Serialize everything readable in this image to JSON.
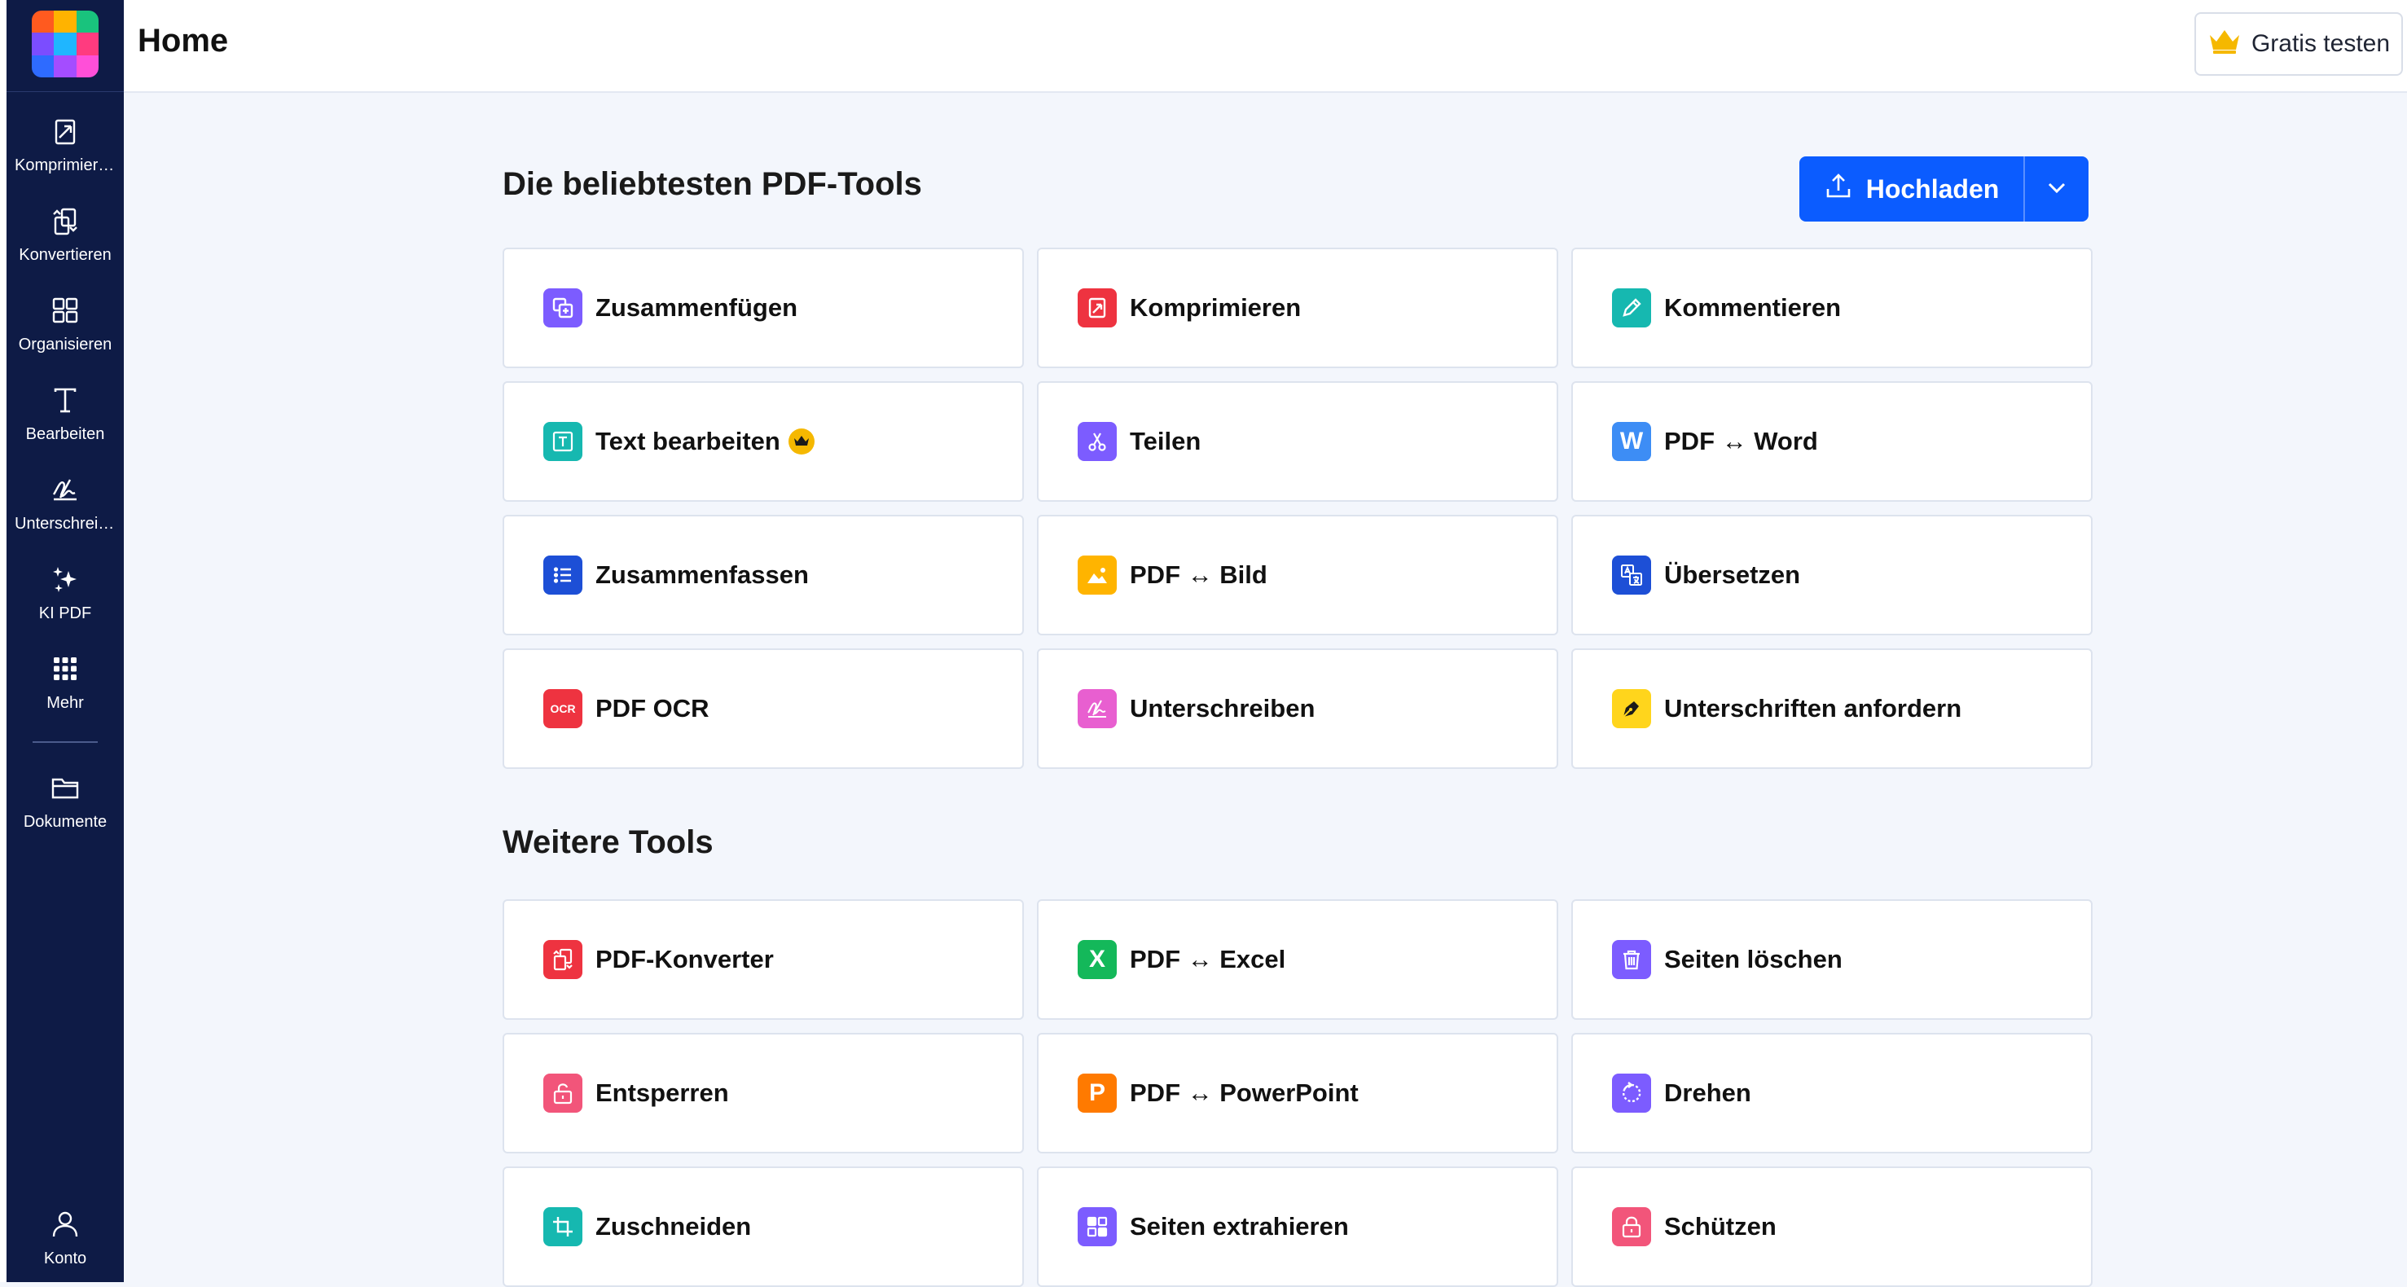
{
  "colors": {
    "sidebar_bg": "#0e1b46",
    "page_bg": "#f3f6fc",
    "primary": "#0b5cff",
    "crown": "#f5b800"
  },
  "logo_colors": [
    "#ff5a1f",
    "#ffb300",
    "#19c37d",
    "#7b4dff",
    "#1fb6ff",
    "#ff3b7f",
    "#2e6bff",
    "#a44dff",
    "#ff4fd8"
  ],
  "header": {
    "title": "Home",
    "trial_label": "Gratis testen"
  },
  "sidebar": {
    "items": [
      {
        "label": "Komprimieren",
        "icon": "compress-icon"
      },
      {
        "label": "Konvertieren",
        "icon": "convert-icon"
      },
      {
        "label": "Organisieren",
        "icon": "organize-icon"
      },
      {
        "label": "Bearbeiten",
        "icon": "edit-text-icon"
      },
      {
        "label": "Unterschreiben",
        "icon": "signature-icon"
      },
      {
        "label": "KI PDF",
        "icon": "ai-sparkle-icon"
      },
      {
        "label": "Mehr",
        "icon": "grid-dots-icon"
      },
      {
        "label": "Dokumente",
        "icon": "folder-icon"
      }
    ],
    "account_label": "Konto"
  },
  "popular": {
    "title": "Die beliebtesten PDF-Tools",
    "upload_label": "Hochladen",
    "tools": [
      {
        "name": "Zusammenfügen",
        "icon": "merge-icon",
        "color": "#7c5cff"
      },
      {
        "name": "Komprimieren",
        "icon": "compress-icon",
        "color": "#ee3340"
      },
      {
        "name": "Kommentieren",
        "icon": "pencil-icon",
        "color": "#16b8b0"
      },
      {
        "name": "Text bearbeiten",
        "icon": "text-edit-icon",
        "color": "#16b8b0",
        "premium": true
      },
      {
        "name": "Teilen",
        "icon": "scissors-icon",
        "color": "#7c5cff"
      },
      {
        "name": "PDF ↔ Word",
        "icon": "word-icon",
        "color": "#3d8df5"
      },
      {
        "name": "Zusammenfassen",
        "icon": "list-icon",
        "color": "#1d4fd6"
      },
      {
        "name": "PDF ↔ Bild",
        "icon": "image-icon",
        "color": "#ffb400"
      },
      {
        "name": "Übersetzen",
        "icon": "translate-icon",
        "color": "#1d4fd6"
      },
      {
        "name": "PDF OCR",
        "icon": "ocr-icon",
        "color": "#ee3340"
      },
      {
        "name": "Unterschreiben",
        "icon": "signature-icon",
        "color": "#e85fd0"
      },
      {
        "name": "Unterschriften anfordern",
        "icon": "pen-nib-icon",
        "color": "#ffd51c"
      }
    ]
  },
  "more": {
    "title": "Weitere Tools",
    "tools": [
      {
        "name": "PDF-Konverter",
        "icon": "convert-icon",
        "color": "#ee3340"
      },
      {
        "name": "PDF ↔ Excel",
        "icon": "excel-icon",
        "color": "#14b85a"
      },
      {
        "name": "Seiten löschen",
        "icon": "trash-icon",
        "color": "#7c5cff"
      },
      {
        "name": "Entsperren",
        "icon": "unlock-icon",
        "color": "#f2557a"
      },
      {
        "name": "PDF ↔ PowerPoint",
        "icon": "powerpoint-icon",
        "color": "#ff7a00"
      },
      {
        "name": "Drehen",
        "icon": "rotate-icon",
        "color": "#7c5cff"
      },
      {
        "name": "Zuschneiden",
        "icon": "crop-icon",
        "color": "#16b8b0"
      },
      {
        "name": "Seiten extrahieren",
        "icon": "extract-pages-icon",
        "color": "#7c5cff"
      },
      {
        "name": "Schützen",
        "icon": "lock-icon",
        "color": "#f2557a"
      }
    ]
  }
}
